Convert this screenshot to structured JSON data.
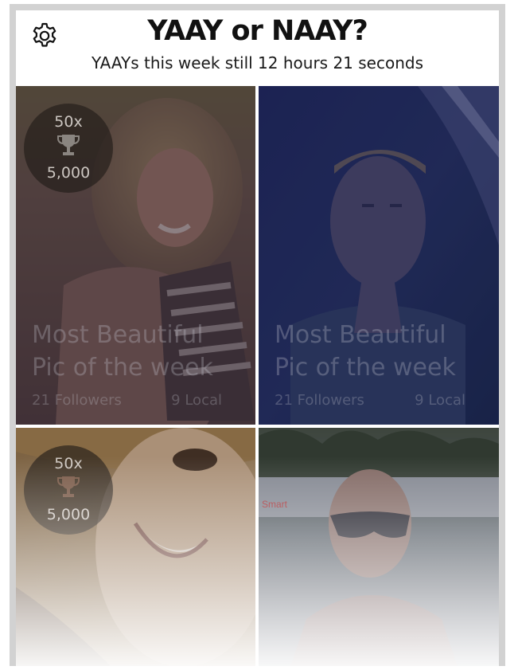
{
  "header": {
    "title": "YAAY or NAAY?",
    "subtitle": "YAAYs this week still 12 hours 21 seconds"
  },
  "tiles": [
    {
      "badge": {
        "multiplier": "50x",
        "score": "5,000",
        "icon": "trophy-icon"
      },
      "caption_line1": "Most Beautiful",
      "caption_line2": "Pic of the week",
      "followers": "21 Followers",
      "local": "9 Local"
    },
    {
      "caption_line1": "Most Beautiful",
      "caption_line2": "Pic of the week",
      "followers": "21 Followers",
      "local": "9 Local"
    },
    {
      "badge": {
        "multiplier": "50x",
        "score": "5,000",
        "icon": "trophy-icon"
      }
    },
    {
      "photo_text": "Smart"
    }
  ],
  "colors": {
    "frame": "#d2d2d2",
    "title": "#111111",
    "tile_blue_overlay": "#1e2a52",
    "tile_dark_overlay": "#2a2430"
  }
}
